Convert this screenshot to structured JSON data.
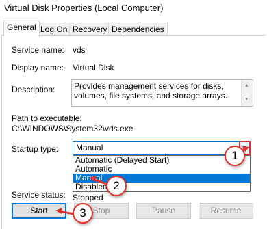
{
  "window": {
    "title": "Virtual Disk Properties (Local Computer)"
  },
  "tabs": [
    {
      "label": "General",
      "active": true
    },
    {
      "label": "Log On",
      "active": false
    },
    {
      "label": "Recovery",
      "active": false
    },
    {
      "label": "Dependencies",
      "active": false
    }
  ],
  "general": {
    "service_name_label": "Service name:",
    "service_name_value": "vds",
    "display_name_label": "Display name:",
    "display_name_value": "Virtual Disk",
    "description_label": "Description:",
    "description_value": "Provides management services for disks, volumes, file systems, and storage arrays.",
    "path_label": "Path to executable:",
    "path_value": "C:\\WINDOWS\\System32\\vds.exe",
    "startup_type_label": "Startup type:",
    "startup_type_value": "Manual",
    "startup_options": [
      "Automatic (Delayed Start)",
      "Automatic",
      "Manual",
      "Disabled"
    ],
    "service_status_label": "Service status:",
    "service_status_value": "Stopped"
  },
  "buttons": {
    "start": "Start",
    "stop": "Stop",
    "pause": "Pause",
    "resume": "Resume"
  },
  "callouts": [
    "1",
    "2",
    "3"
  ],
  "colors": {
    "accent": "#0078d7",
    "callout": "#e2302b"
  }
}
